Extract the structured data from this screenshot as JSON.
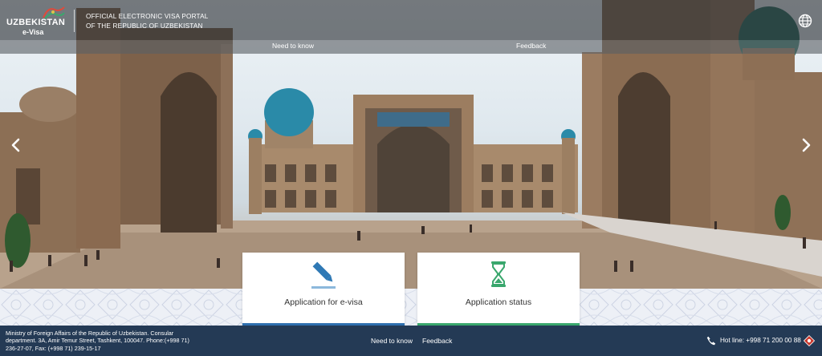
{
  "header": {
    "logo_word": "UZBEKISTAN",
    "logo_sub": "e-Visa",
    "portal_title_line1": "OFFICIAL ELECTRONIC VISA PORTAL",
    "portal_title_line2": "OF THE REPUBLIC OF UZBEKISTAN",
    "language_icon": "globe-icon"
  },
  "nav": {
    "need_to_know": "Need to know",
    "feedback": "Feedback"
  },
  "carousel": {
    "prev_icon": "chevron-left-icon",
    "next_icon": "chevron-right-icon"
  },
  "cards": {
    "apply": {
      "label": "Application for e-visa",
      "icon": "pencil-icon",
      "accent": "#2f6fae"
    },
    "status": {
      "label": "Application status",
      "icon": "hourglass-icon",
      "accent": "#3aa76d"
    }
  },
  "footer": {
    "info_line1": "Ministry of Foreign Affairs of the Republic of Uzbekistan. Consular",
    "info_line2": "department. 3A, Amir Temur Street, Tashkent, 100047. Phone:(+998 71)",
    "info_line3": "236-27-07, Fax: (+998 71) 239-15-17",
    "need_to_know": "Need to know",
    "feedback": "Feedback",
    "hotline": "Hot line: +998 71 200 00 88",
    "hotline_icon": "phone-icon"
  },
  "colors": {
    "footer_bg": "#243a55",
    "apply_accent": "#2f6fae",
    "status_accent": "#3aa76d"
  }
}
